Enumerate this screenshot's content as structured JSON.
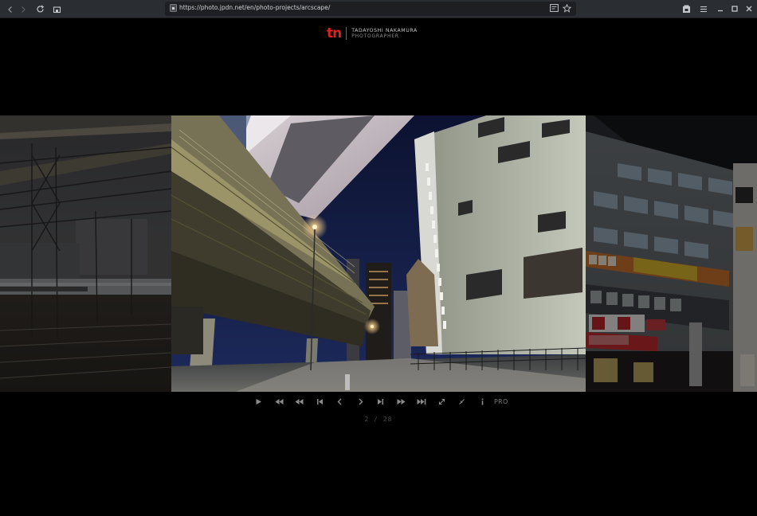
{
  "browser": {
    "url": "https://photo.jpdn.net/en/photo-projects/arcscape/"
  },
  "header": {
    "logo_mark": "tn",
    "name": "TADAYOSHI NAKAMURA",
    "subtitle": "PHOTOGRAPHER"
  },
  "controls": {
    "pro_label": "PRO"
  },
  "counter": {
    "current": "2",
    "separator": "/",
    "total": "28"
  },
  "colors": {
    "brand_red": "#d8231f",
    "background": "#000000",
    "chrome": "#2a2d31"
  }
}
